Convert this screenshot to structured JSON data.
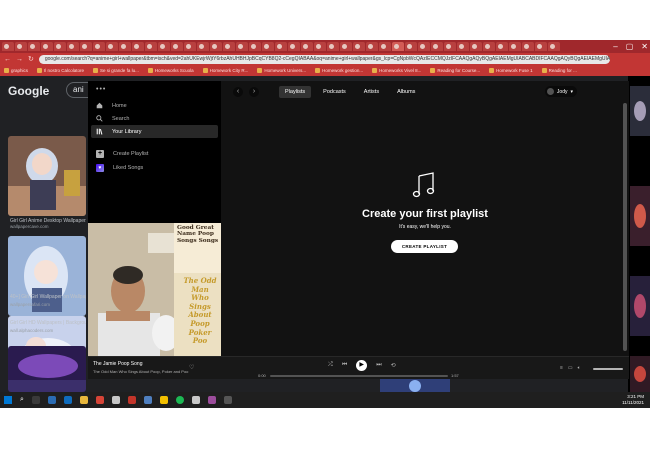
{
  "browser": {
    "url": "google.com/search?q=anime+girl+wallpaper&tbm=isch&ved=2ahUKEwjrWjtY6rbzAhUHBHJpBCqCYB8Q2-cCegQIABAA&oq=anime+girl+wallpaper&gs_lcp=CgNpbWcQAzIECCMQJzIFCAAQgAQyBQgAEIAEMgUIABCABDIFCAAQgAQyBQgAEIAEMgUIABCABDIFCAAQgAQ",
    "bookmarks": [
      "graphics",
      "Il nostro Calcolatore",
      "Se si grande fa lu...",
      "Homeworks Scuola",
      "Homework City R...",
      "Homework Univers...",
      "Homework gestion...",
      "Homeworks Vivel 8...",
      "Reading for Course...",
      "Homework Fuse 1",
      "Reading for ..."
    ]
  },
  "google": {
    "logo": "Google",
    "query": "ani",
    "results": [
      {
        "caption": "Girl Girl Anime Desktop Wallpapers",
        "site": "wallpapercave.com"
      },
      {
        "caption": "40+] Girl Girl Wallpaper on WallpaperSafari",
        "site": "wallpapersafari.com"
      },
      {
        "caption": "Girl Girl HD Wallpapers | Background",
        "site": "wall.alphacoders.com"
      }
    ]
  },
  "spotify": {
    "dots": "•••",
    "nav": [
      {
        "label": "Home",
        "icon": "home-icon"
      },
      {
        "label": "Search",
        "icon": "search-icon"
      },
      {
        "label": "Your Library",
        "icon": "library-icon"
      }
    ],
    "create_playlist": "Create Playlist",
    "liked_songs": "Liked Songs",
    "tabs": [
      "Playlists",
      "Podcasts",
      "Artists",
      "Albums"
    ],
    "user": "Jody",
    "empty": {
      "title": "Create your first playlist",
      "subtitle": "It's easy, we'll help you.",
      "button": "CREATE PLAYLIST"
    },
    "cover_text": [
      "Good Great",
      "Name Poop",
      "Songs Songs",
      "The Odd",
      "Man",
      "Who",
      "Sings",
      "About",
      "Poop",
      "Poker",
      "Poo"
    ],
    "now_playing": {
      "title": "The Jamie Poop Song",
      "artist": "The Odd Man Who Sings About Poop, Poker and Poo",
      "elapsed": "0:00",
      "duration": "1:57",
      "progress": 0.0
    }
  },
  "taskbar": {
    "time": "3:21 PM",
    "date": "11/11/2021"
  },
  "colors": {
    "chrome_red": "#c23634",
    "spotify_bg": "#121212",
    "spotify_sidebar": "#000000"
  }
}
